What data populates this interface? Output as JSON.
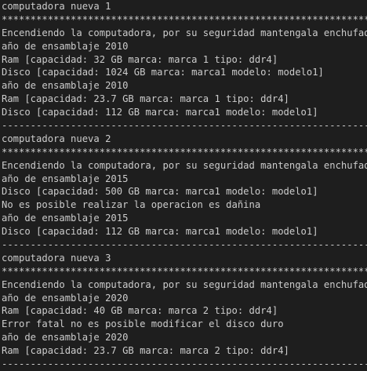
{
  "terminal": {
    "lines": [
      "computadora nueva 1",
      "******************************************************************",
      "Encendiendo la computadora, por su seguridad mantengala enchufada",
      "año de ensamblaje 2010",
      "Ram [capacidad: 32 GB marca: marca 1 tipo: ddr4]",
      "Disco [capacidad: 1024 GB marca: marca1 modelo: modelo1]",
      "año de ensamblaje 2010",
      "Ram [capacidad: 23.7 GB marca: marca 1 tipo: ddr4]",
      "Disco [capacidad: 112 GB marca: marca1 modelo: modelo1]",
      "------------------------------------------------------------------",
      "computadora nueva 2",
      "******************************************************************",
      "Encendiendo la computadora, por su seguridad mantengala enchufada",
      "año de ensamblaje 2015",
      "Disco [capacidad: 500 GB marca: marca1 modelo: modelo1]",
      "No es posible realizar la operacion es dañina",
      "año de ensamblaje 2015",
      "Disco [capacidad: 112 GB marca: marca1 modelo: modelo1]",
      "------------------------------------------------------------------",
      "computadora nueva 3",
      "******************************************************************",
      "Encendiendo la computadora, por su seguridad mantengala enchufada",
      "año de ensamblaje 2020",
      "Ram [capacidad: 40 GB marca: marca 2 tipo: ddr4]",
      "Error fatal no es posible modificar el disco duro",
      "año de ensamblaje 2020",
      "Ram [capacidad: 23.7 GB marca: marca 2 tipo: ddr4]",
      "------------------------------------------------------------------"
    ]
  }
}
